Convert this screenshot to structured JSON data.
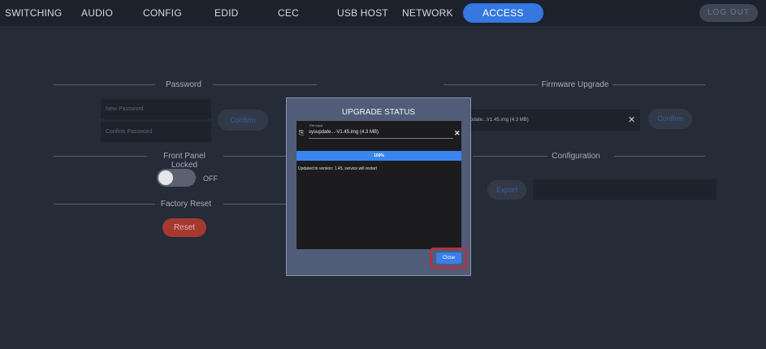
{
  "nav": {
    "items": [
      "SWITCHING",
      "AUDIO",
      "CONFIG",
      "EDID",
      "CEC",
      "USB HOST",
      "NETWORK",
      "ACCESS"
    ],
    "active": "ACCESS",
    "logout_label": "LOG OUT"
  },
  "password": {
    "title": "Password",
    "new_placeholder": "New Password",
    "confirm_placeholder": "Confirm Password",
    "confirm_button": "Confirm"
  },
  "front_panel": {
    "title": "Front Panel Locked",
    "toggle_state": "OFF"
  },
  "factory_reset": {
    "title": "Factory Reset",
    "reset_button": "Reset"
  },
  "firmware": {
    "title": "Firmware Upgrade",
    "file_value": "pdate...V1.45.img (4.3 MB)",
    "confirm_button": "Confirm"
  },
  "configuration": {
    "title": "Configuration",
    "export_button": "Export"
  },
  "modal": {
    "title": "UPGRADE STATUS",
    "file_label": "File input",
    "file_name": "sysupdate...-V1.45.img (4.3 MB)",
    "progress_percent": 100,
    "progress_text": "100%",
    "status_text": "Updated to version: 1.45, service will restart",
    "close_button": "Close"
  },
  "colors": {
    "accent": "#3478e0",
    "reset": "#a43a2f",
    "highlight": "#d62430"
  }
}
